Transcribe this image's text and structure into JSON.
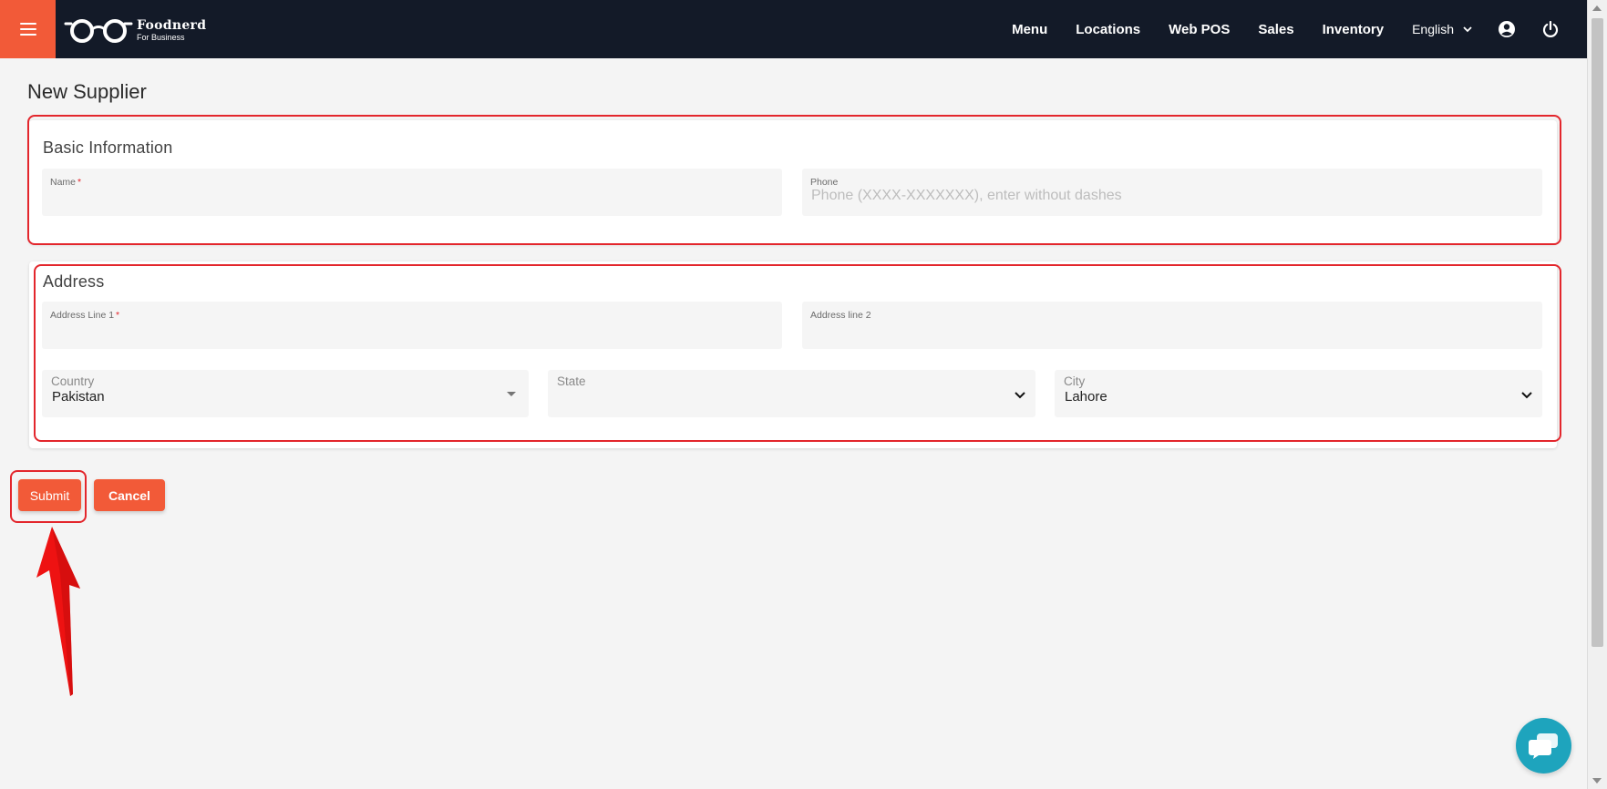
{
  "header": {
    "brand_name": "Foodnerd",
    "brand_tagline": "For Business",
    "nav_items": [
      "Menu",
      "Locations",
      "Web POS",
      "Sales",
      "Inventory"
    ],
    "language": "English",
    "accent_color": "#f25a38",
    "bar_color": "#131a28"
  },
  "page": {
    "title": "New Supplier"
  },
  "basic_information": {
    "title": "Basic Information",
    "name_label": "Name",
    "name_required_mark": "*",
    "name_value": "",
    "phone_label": "Phone",
    "phone_placeholder": "Phone (XXXX-XXXXXXX), enter without dashes",
    "phone_value": ""
  },
  "address": {
    "title": "Address",
    "line1_label": "Address Line 1",
    "line1_required_mark": "*",
    "line1_value": "",
    "line2_label": "Address line 2",
    "line2_value": "",
    "country_label": "Country",
    "country_value": "Pakistan",
    "state_label": "State",
    "state_value": "",
    "city_label": "City",
    "city_value": "Lahore"
  },
  "actions": {
    "submit_label": "Submit",
    "cancel_label": "Cancel"
  },
  "icons": {
    "menu": "hamburger-icon",
    "account": "account-circle-icon",
    "logout": "power-icon",
    "chat": "chat-bubbles-icon",
    "annotation": "red-arrow-icon"
  },
  "annotation_color": "#e3262c"
}
